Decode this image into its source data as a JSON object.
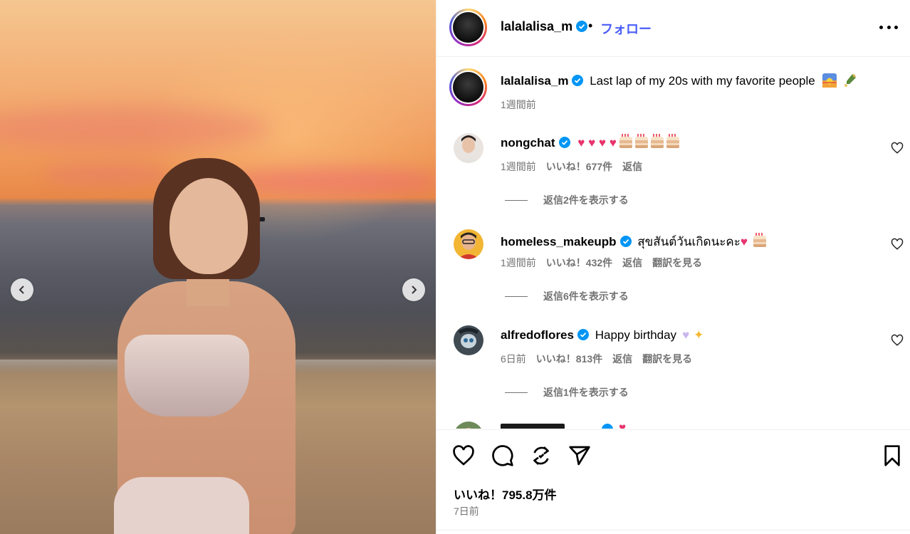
{
  "post": {
    "username": "lalalalisa_m",
    "follow_label": "フォロー",
    "dot": "•",
    "caption": "Last lap of my 20s with my favorite people",
    "caption_time": "1週間前",
    "likes": "いいね！795.8万件",
    "posted": "7日前"
  },
  "comments": [
    {
      "username": "nongchat",
      "time": "1週間前",
      "likes": "いいね！677件",
      "reply": "返信",
      "view_replies": "返信2件を表示する"
    },
    {
      "username": "homeless_makeupb",
      "text": "สุขสันต์วันเกิดนะคะ",
      "time": "1週間前",
      "likes": "いいね！432件",
      "reply": "返信",
      "translate": "翻訳を見る",
      "view_replies": "返信6件を表示する"
    },
    {
      "username": "alfredoflores",
      "text": "Happy birthday",
      "time": "6日前",
      "likes": "いいね！813件",
      "reply": "返信",
      "translate": "翻訳を見る",
      "view_replies": "返信1件を表示する"
    }
  ],
  "colors": {
    "follow": "#4a5df9",
    "verified": "#0095f6",
    "meta": "#737373"
  }
}
